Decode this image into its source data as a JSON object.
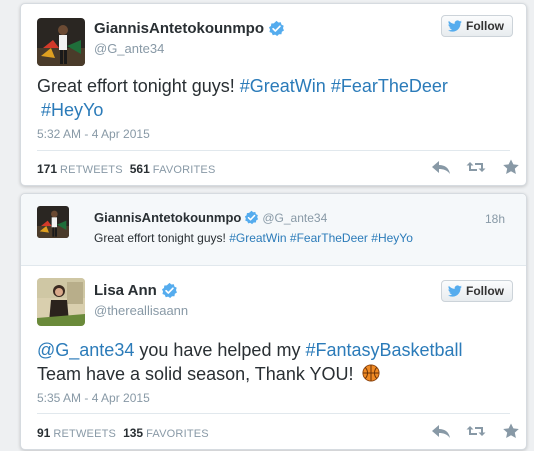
{
  "tweet1": {
    "name": "GiannisAntetokounmpo",
    "handle": "@G_ante34",
    "follow_label": "Follow",
    "text_lead": "Great effort tonight guys! ",
    "hashtags": [
      "#GreatWin",
      "#FearTheDeer",
      "#HeyYo"
    ],
    "timestamp": "5:32 AM - 4 Apr 2015",
    "retweets": "171",
    "retweets_label": "RETWEETS",
    "favorites": "561",
    "favorites_label": "FAVORITES"
  },
  "quoted": {
    "name": "GiannisAntetokounmpo",
    "handle": "@G_ante34",
    "time": "18h",
    "text_lead": "Great effort tonight guys! ",
    "hashtags": [
      "#GreatWin",
      "#FearTheDeer",
      "#HeyYo"
    ]
  },
  "tweet2": {
    "name": "Lisa Ann",
    "handle": "@thereallisaann",
    "follow_label": "Follow",
    "mention": "@G_ante34",
    "text_mid": " you have helped my ",
    "hashtag": "#FantasyBasketball",
    "text_line2": "Team have a solid season, Thank YOU!",
    "emoji": "basketball-icon",
    "timestamp": "5:35 AM - 4 Apr 2015",
    "retweets": "91",
    "retweets_label": "RETWEETS",
    "favorites": "135",
    "favorites_label": "FAVORITES"
  },
  "colors": {
    "link": "#2b7bb9",
    "muted": "#8899a6",
    "verified": "#55acee",
    "twitter_bird": "#55acee"
  }
}
